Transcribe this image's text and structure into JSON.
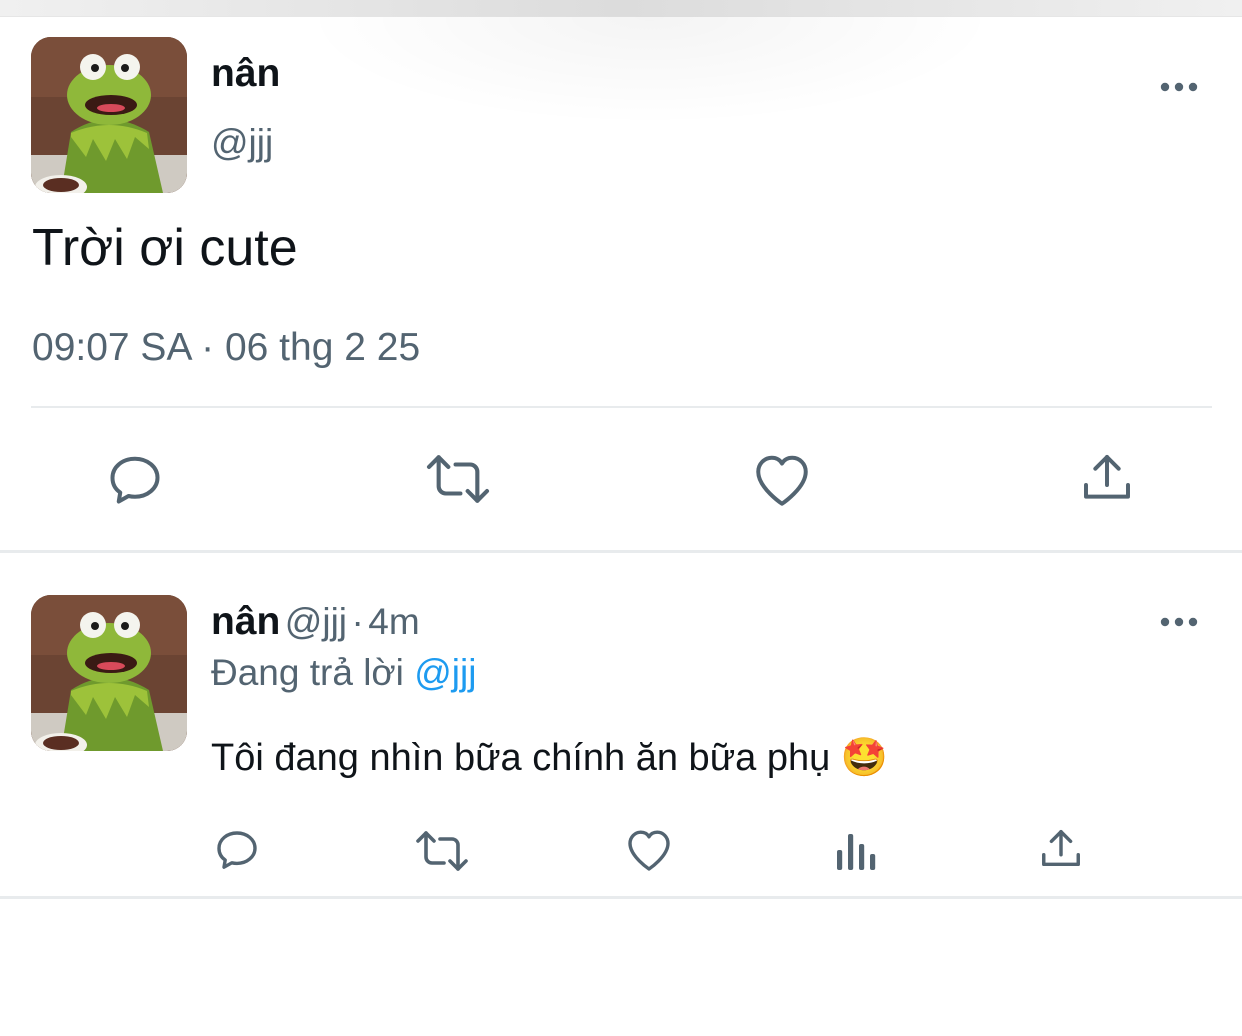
{
  "main_tweet": {
    "display_name": "nân",
    "handle": "@jjj",
    "text": "Trời ơi cute",
    "timestamp": "09:07 SA · 06 thg 2 25",
    "more_label": "•••"
  },
  "reply_tweet": {
    "display_name": "nân",
    "handle": "@jjj",
    "dot": "·",
    "age": "4m",
    "replying_prefix": "Đang trả lời",
    "replying_to": "@jjj",
    "text": "Tôi đang nhìn bữa chính ăn bữa phụ",
    "emoji": "🤩",
    "more_label": "•••"
  },
  "colors": {
    "text_primary": "#0f1419",
    "text_secondary": "#536471",
    "link": "#1d9bf0",
    "divider": "#e8ebed"
  },
  "icons": [
    "reply-icon",
    "retweet-icon",
    "like-icon",
    "views-icon",
    "share-icon",
    "more-icon"
  ]
}
